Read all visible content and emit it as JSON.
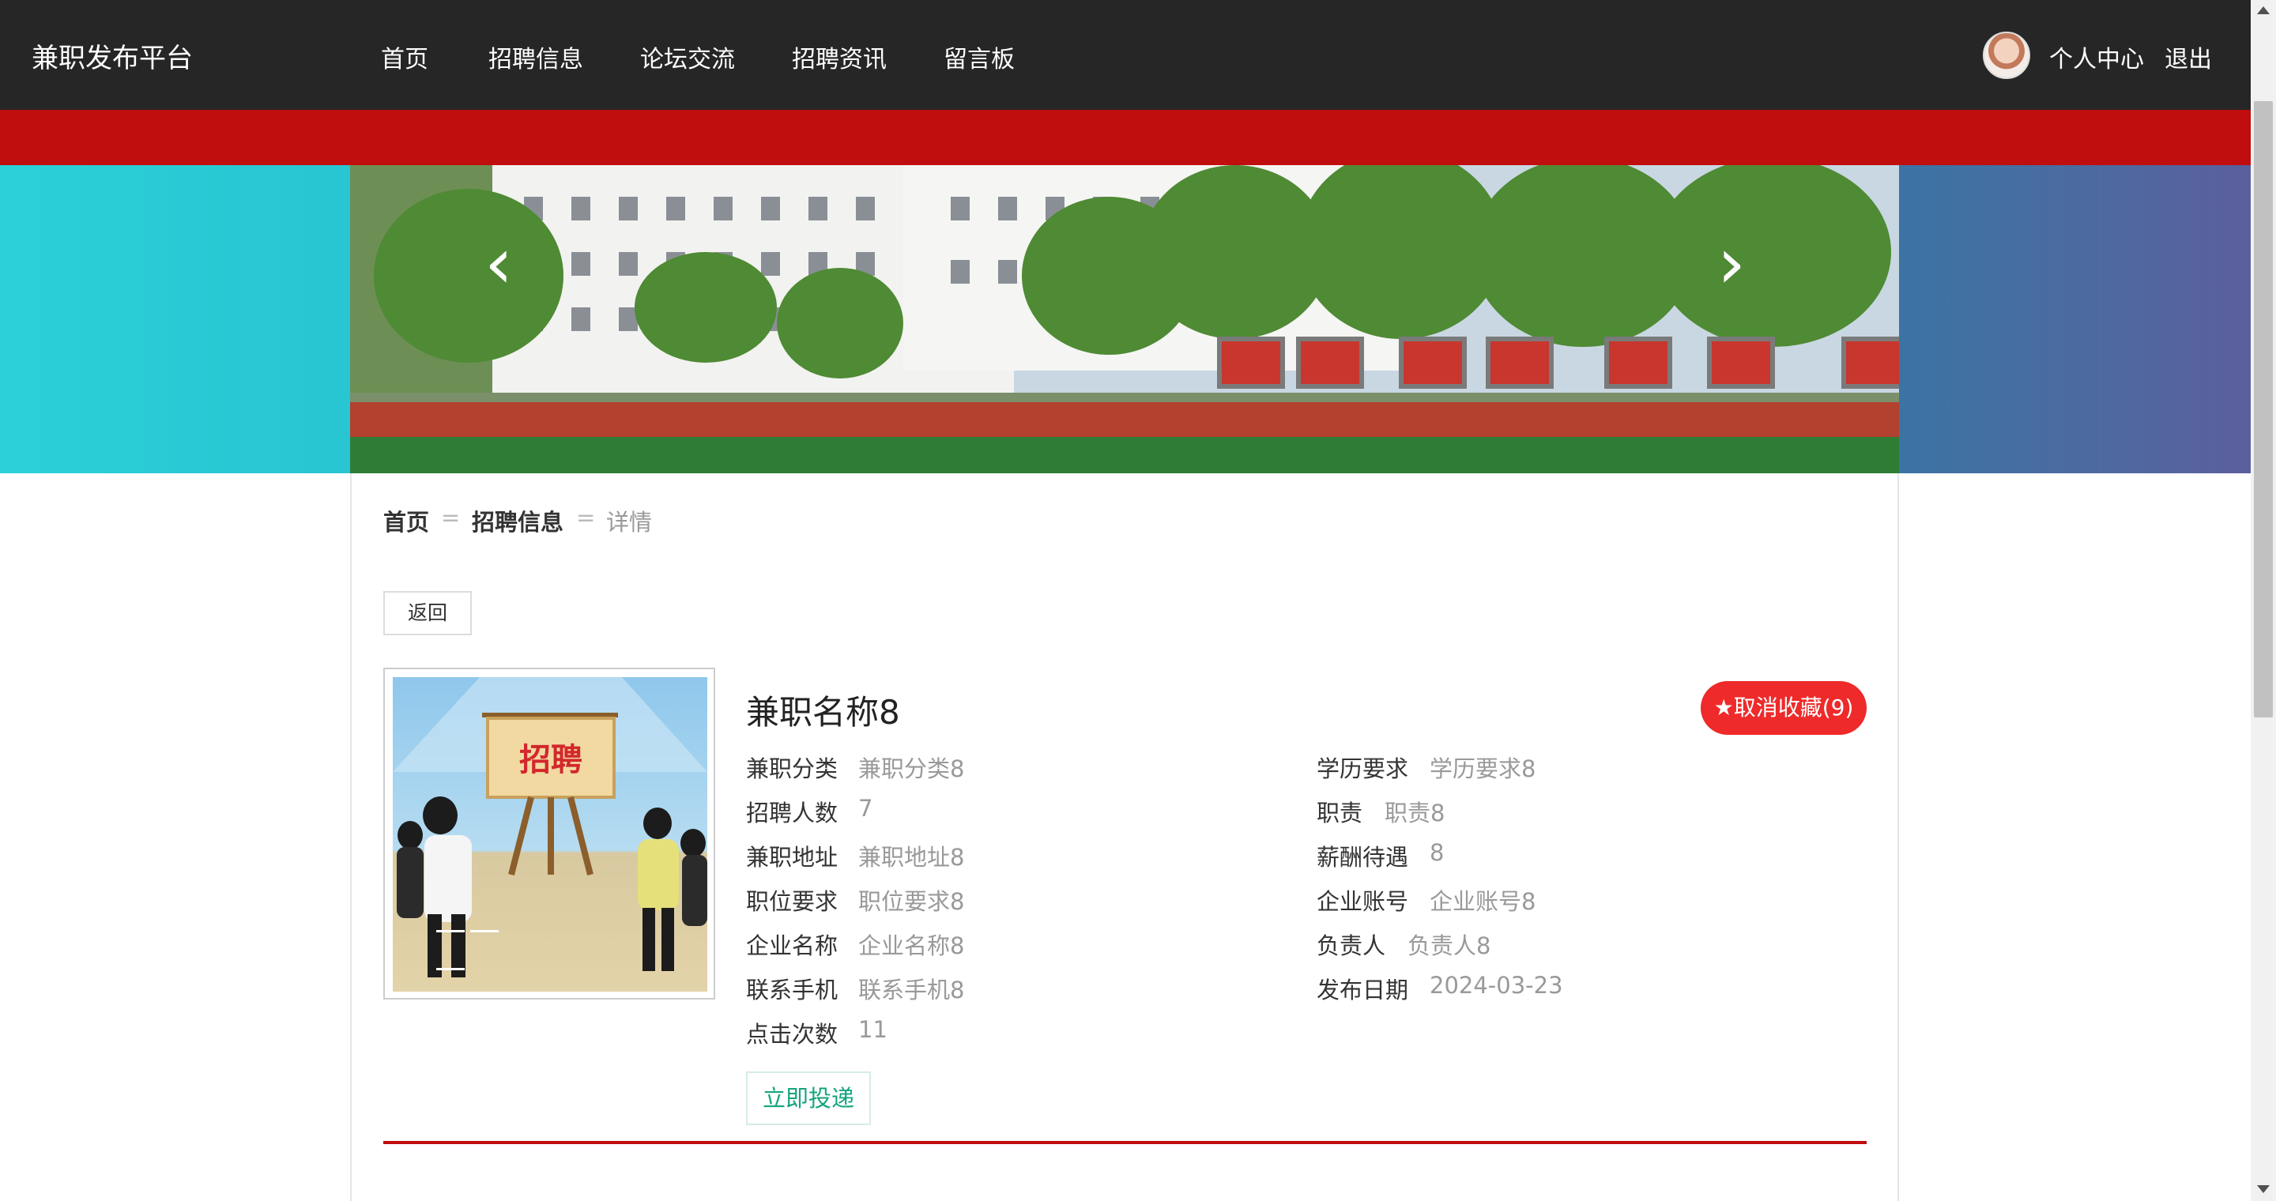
{
  "header": {
    "brand": "兼职发布平台",
    "nav": [
      "首页",
      "招聘信息",
      "论坛交流",
      "招聘资讯",
      "留言板"
    ],
    "user_center": "个人中心",
    "logout": "退出"
  },
  "carousel": {
    "prev_symbol": "‹",
    "next_symbol": "›",
    "slide_count": 3,
    "active_index": 1,
    "active_dot_color": "#c00d0d"
  },
  "breadcrumb": {
    "items": [
      "首页",
      "招聘信息",
      "详情"
    ],
    "separator": "="
  },
  "back_label": "返回",
  "poster": {
    "sign_text": "招聘"
  },
  "job": {
    "title": "兼职名称8",
    "favorite_label": "★取消收藏(9)",
    "fields_left": [
      {
        "label": "兼职分类",
        "value": "兼职分类8"
      },
      {
        "label": "招聘人数",
        "value": "7"
      },
      {
        "label": "兼职地址",
        "value": "兼职地址8"
      },
      {
        "label": "职位要求",
        "value": "职位要求8"
      },
      {
        "label": "企业名称",
        "value": "企业名称8"
      },
      {
        "label": "联系手机",
        "value": "联系手机8"
      },
      {
        "label": "点击次数",
        "value": "11"
      }
    ],
    "fields_right": [
      {
        "label": "学历要求",
        "value": "学历要求8"
      },
      {
        "label": "职责",
        "value": "职责8"
      },
      {
        "label": "薪酬待遇",
        "value": "8"
      },
      {
        "label": "企业账号",
        "value": "企业账号8"
      },
      {
        "label": "负责人",
        "value": "负责人8"
      },
      {
        "label": "发布日期",
        "value": "2024-03-23"
      }
    ],
    "apply_label": "立即投递"
  },
  "colors": {
    "nav_bg": "#262626",
    "accent_red": "#c00d0d",
    "favorite_red": "#ee2a2a",
    "apply_green": "#15a57e"
  }
}
